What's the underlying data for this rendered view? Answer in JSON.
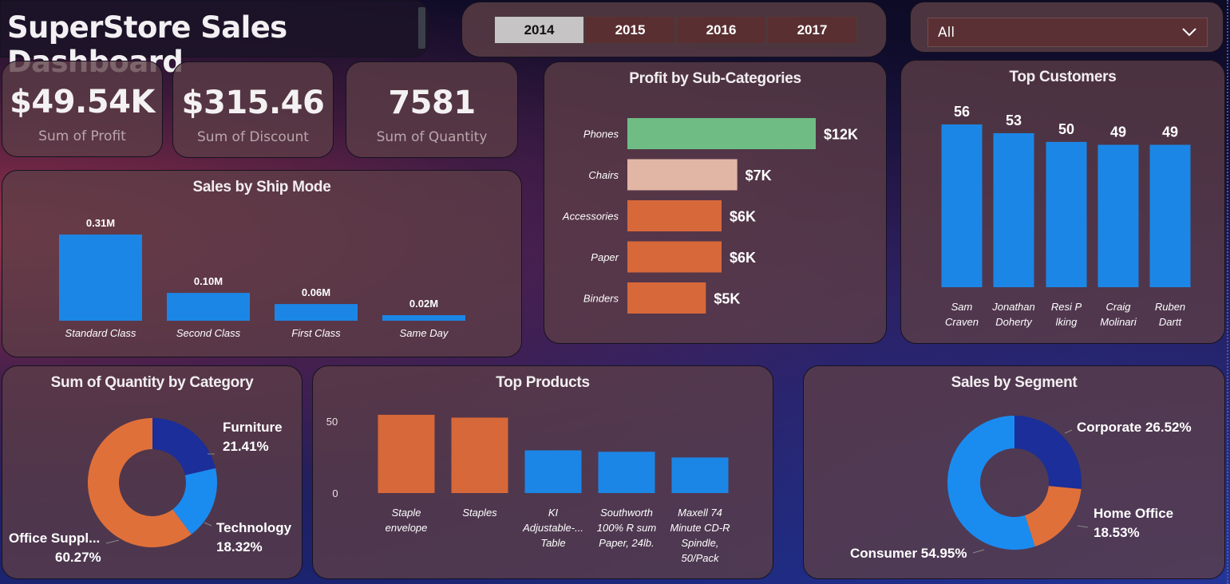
{
  "header": {
    "title": "SuperStore Sales Dashboard",
    "years": [
      "2014",
      "2015",
      "2016",
      "2017"
    ],
    "selected_year": "2014",
    "filter": {
      "value": "All",
      "icon": "chevron-down-icon"
    }
  },
  "kpis": [
    {
      "value": "$49.54K",
      "label": "Sum of Profit"
    },
    {
      "value": "$315.46",
      "label": "Sum of Discount"
    },
    {
      "value": "7581",
      "label": "Sum of Quantity"
    }
  ],
  "colors": {
    "blue": "#1c86e6",
    "orange": "#d7683a",
    "green": "#6fbd85",
    "peach": "#e2b6a5",
    "navy": "#1b2e99",
    "bright_blue": "#1a8cf0"
  },
  "chart_data": [
    {
      "type": "bar",
      "title": "Sales  by Ship Mode",
      "categories": [
        "Standard Class",
        "Second Class",
        "First Class",
        "Same Day"
      ],
      "values": [
        0.31,
        0.1,
        0.06,
        0.02
      ],
      "labels": [
        "0.31M",
        "0.10M",
        "0.06M",
        "0.02M"
      ],
      "unit": "M"
    },
    {
      "type": "bar",
      "orientation": "horizontal",
      "title": "Profit by Sub-Categories",
      "categories": [
        "Phones",
        "Chairs",
        "Accessories",
        "Paper",
        "Binders"
      ],
      "values": [
        12,
        7,
        6,
        6,
        5
      ],
      "labels": [
        "$12K",
        "$7K",
        "$6K",
        "$6K",
        "$5K"
      ],
      "bar_colors": [
        "#6fbd85",
        "#e2b6a5",
        "#d7683a",
        "#d7683a",
        "#d7683a"
      ]
    },
    {
      "type": "bar",
      "title": "Top Customers",
      "categories": [
        "Sam Craven",
        "Jonathan Doherty",
        "Resi P lking",
        "Craig Molinari",
        "Ruben Dartt"
      ],
      "category_lines": [
        [
          "Sam",
          "Craven"
        ],
        [
          "Jonathan",
          "Doherty"
        ],
        [
          "Resi P",
          "lking"
        ],
        [
          "Craig",
          "Molinari"
        ],
        [
          "Ruben",
          "Dartt"
        ]
      ],
      "values": [
        56,
        53,
        50,
        49,
        49
      ]
    },
    {
      "type": "pie",
      "title": "Sum of Quantity by Category",
      "slices": [
        {
          "name": "Furniture",
          "value": 21.41,
          "label": "21.41%",
          "color": "#1b2e99"
        },
        {
          "name": "Technology",
          "value": 18.32,
          "label": "18.32%",
          "color": "#1a8cf0"
        },
        {
          "name": "Office Suppl...",
          "value": 60.27,
          "label": "60.27%",
          "color": "#e0703a"
        }
      ]
    },
    {
      "type": "bar",
      "title": "Top Products",
      "categories": [
        "Staple envelope",
        "Staples",
        "KI Adjustable-... Table",
        "Southworth 100% R sum Paper, 24lb.",
        "Maxell 74 Minute CD-R Spindle, 50/Pack"
      ],
      "category_lines": [
        [
          "Staple",
          "envelope"
        ],
        [
          "Staples"
        ],
        [
          "KI",
          "Adjustable-...",
          "Table"
        ],
        [
          "Southworth",
          "100% R sum",
          "Paper, 24lb."
        ],
        [
          "Maxell 74",
          "Minute CD-R",
          "Spindle,",
          "50/Pack"
        ]
      ],
      "values": [
        55,
        53,
        30,
        29,
        25
      ],
      "yticks": [
        "50",
        "0"
      ],
      "bar_colors": [
        "#d7683a",
        "#d7683a",
        "#1c86e6",
        "#1c86e6",
        "#1c86e6"
      ]
    },
    {
      "type": "pie",
      "title": "Sales by Segment",
      "slices": [
        {
          "name": "Corporate",
          "value": 26.52,
          "label": "Corporate 26.52%",
          "color": "#1b2e99"
        },
        {
          "name": "Home Office",
          "value": 18.53,
          "label": "18.53%",
          "color": "#e0703a"
        },
        {
          "name": "Consumer",
          "value": 54.95,
          "label": "Consumer 54.95%",
          "color": "#1a8cf0"
        }
      ]
    }
  ]
}
